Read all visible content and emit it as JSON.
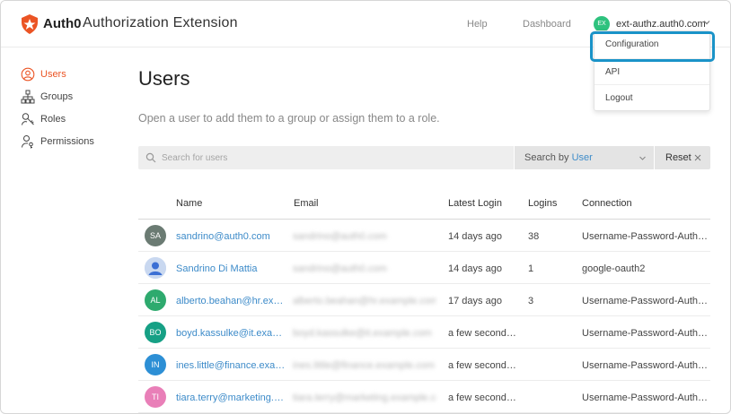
{
  "app": {
    "brand": "Auth0",
    "title": "Authorization Extension",
    "accent_color": "#eb5424",
    "link_color": "#3d8bc9",
    "highlight_color": "#1a93c8"
  },
  "nav": {
    "help": "Help",
    "dashboard": "Dashboard",
    "user_initials": "EX",
    "user_name": "ext-authz.auth0.com"
  },
  "dropdown": {
    "items": [
      "Configuration",
      "API",
      "Logout"
    ]
  },
  "sidebar": {
    "items": [
      {
        "label": "Users",
        "icon": "user-circle-icon",
        "active": true
      },
      {
        "label": "Groups",
        "icon": "hierarchy-icon"
      },
      {
        "label": "Roles",
        "icon": "roles-icon"
      },
      {
        "label": "Permissions",
        "icon": "user-key-icon"
      }
    ]
  },
  "main": {
    "title": "Users",
    "subtitle": "Open a user to add them to a group or assign them to a role.",
    "search_placeholder": "Search for users",
    "search_by_label": "Search by",
    "search_by_value": "User",
    "reset_label": "Reset"
  },
  "table": {
    "headers": [
      "Name",
      "Email",
      "Latest Login",
      "Logins",
      "Connection"
    ],
    "rows": [
      {
        "initials": "SA",
        "avatar_color": "#6b7b73",
        "name": "sandrino@auth0.com",
        "email": "sandrino@auth0.com",
        "latest_login": "14 days ago",
        "logins": "38",
        "connection": "Username-Password-Auth…"
      },
      {
        "initials": "",
        "avatar_color": "#c9d8f0",
        "name": "Sandrino Di Mattia",
        "email": "sandrino@auth0.com",
        "latest_login": "14 days ago",
        "logins": "1",
        "connection": "google-oauth2"
      },
      {
        "initials": "AL",
        "avatar_color": "#2eaa6e",
        "name": "alberto.beahan@hr.ex…",
        "email": "alberto.beahan@hr.example.com",
        "latest_login": "17 days ago",
        "logins": "3",
        "connection": "Username-Password-Auth…"
      },
      {
        "initials": "BO",
        "avatar_color": "#16a085",
        "name": "boyd.kassulke@it.exa…",
        "email": "boyd.kassulke@it.example.com",
        "latest_login": "a few second…",
        "logins": "",
        "connection": "Username-Password-Auth…"
      },
      {
        "initials": "IN",
        "avatar_color": "#2d8fd5",
        "name": "ines.little@finance.exa…",
        "email": "ines.little@finance.example.com",
        "latest_login": "a few second…",
        "logins": "",
        "connection": "Username-Password-Auth…"
      },
      {
        "initials": "TI",
        "avatar_color": "#e97fb8",
        "name": "tiara.terry@marketing.…",
        "email": "tiara.terry@marketing.example.com",
        "latest_login": "a few second…",
        "logins": "",
        "connection": "Username-Password-Auth…"
      }
    ]
  }
}
